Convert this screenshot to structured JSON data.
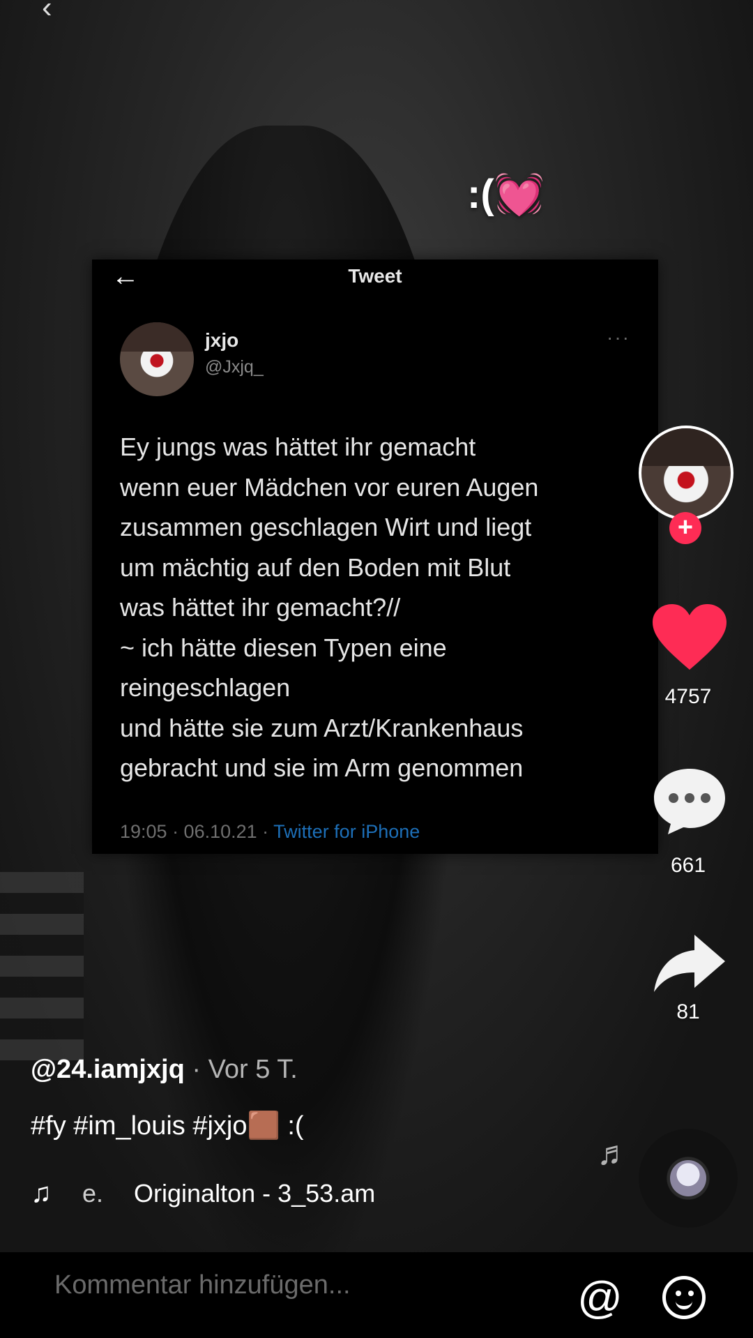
{
  "overlay_caption": ":(💓",
  "tweet": {
    "title": "Tweet",
    "user": "jxjo",
    "handle": "@Jxjq_",
    "more": "···",
    "text": "Ey jungs was hättet ihr gemacht\nwenn euer Mädchen vor euren Augen\nzusammen geschlagen Wirt und liegt\num mächtig auf den Boden mit Blut\nwas hättet ihr gemacht?//\n~ ich hätte diesen Typen eine\nreingeschlagen\nund hätte sie zum Arzt/Krankenhaus\ngebracht und sie im Arm genommen",
    "time": "19:05 · 06.10.21 · ",
    "source": "Twitter for iPhone"
  },
  "rail": {
    "likes": "4757",
    "comments": "661",
    "shares": "81"
  },
  "post": {
    "author": "@24.iamjxjq",
    "ago": " · Vor 5 T.",
    "description": "#fy #im_louis #jxjo🟫 :(",
    "music_faint": "e.",
    "music": "Originalton - 3_53.am"
  },
  "comment_bar": {
    "placeholder": "Kommentar hinzufügen..."
  },
  "colors": {
    "like": "#fe2c55",
    "twitter_link": "#1d6fb8"
  }
}
